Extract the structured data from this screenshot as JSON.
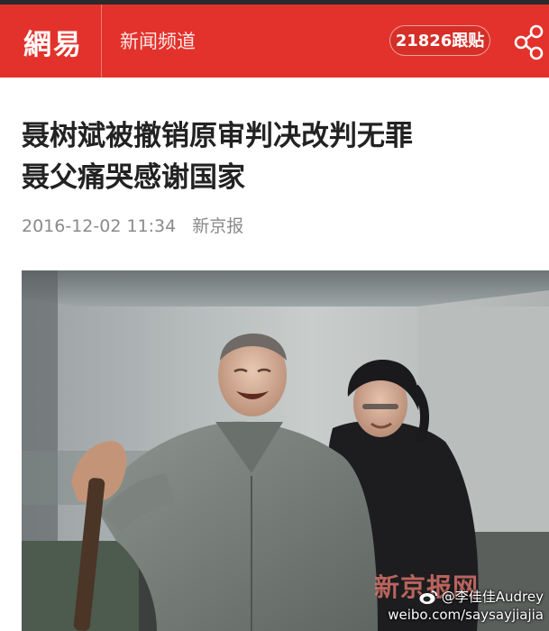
{
  "header": {
    "logo": "網易",
    "channel": "新闻频道",
    "reply_count": "21826跟贴",
    "share_icon": "share-icon",
    "bar_color": "#e3322b"
  },
  "article": {
    "title_line1": "聂树斌被撤销原审判决改判无罪",
    "title_line2": "聂父痛哭感谢国家",
    "datetime": "2016-12-02 11:34",
    "source": "新京报"
  },
  "photo": {
    "watermark": "新京报网",
    "weibo_icon": "weibo-icon",
    "weibo_handle": "@李佳佳Audrey",
    "weibo_url": "weibo.com/saysayjiajia"
  }
}
